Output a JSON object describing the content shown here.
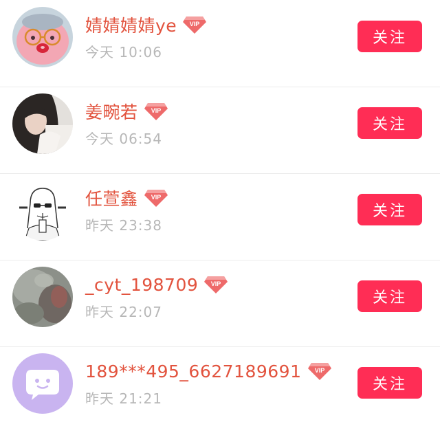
{
  "users": [
    {
      "name": "婧婧婧婧ye",
      "vip_label": "VIP",
      "time": "今天 10:06",
      "follow_label": "关注",
      "avatar": "pink-plush-toy-avatar"
    },
    {
      "name": "姜畹若",
      "vip_label": "VIP",
      "time": "今天 06:54",
      "follow_label": "关注",
      "avatar": "girl-photo-avatar"
    },
    {
      "name": "任萱鑫",
      "vip_label": "VIP",
      "time": "昨天 23:38",
      "follow_label": "关注",
      "avatar": "sunglasses-sketch-avatar"
    },
    {
      "name": "_cyt_198709",
      "vip_label": "VIP",
      "time": "昨天 22:07",
      "follow_label": "关注",
      "avatar": "blurry-photo-avatar"
    },
    {
      "name": "189***495_6627189691",
      "vip_label": "VIP",
      "time": "昨天 21:21",
      "follow_label": "关注",
      "avatar": "default-chat-bubble-avatar"
    }
  ],
  "colors": {
    "name": "#e2533e",
    "time": "#b7b7b7",
    "follow_button": "#ff2d55",
    "vip_badge": "#ee6a6a",
    "default_avatar_bg": "#c9b4f0"
  }
}
